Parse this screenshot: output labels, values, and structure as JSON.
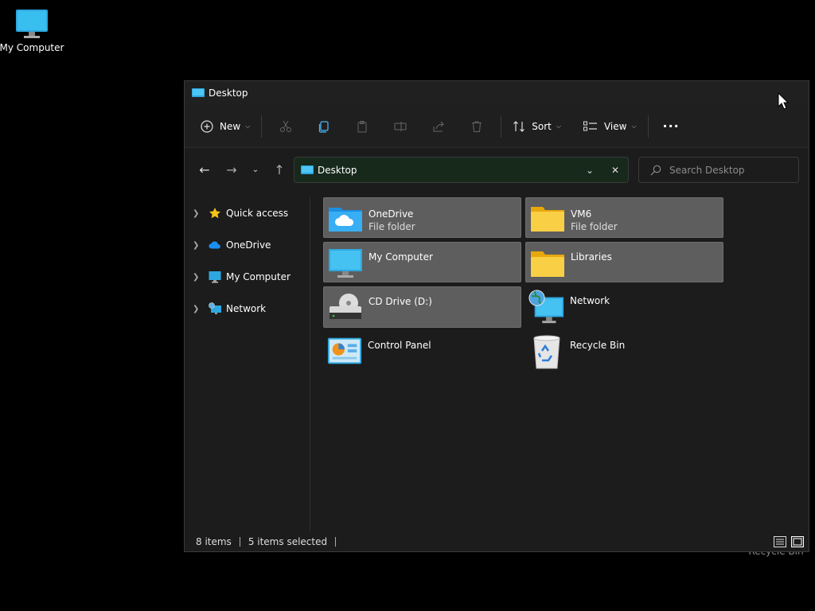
{
  "desktop": {
    "my_computer_label": "My Computer",
    "recycle_bin_label": "Recycle Bin"
  },
  "window": {
    "title": "Desktop"
  },
  "toolbar": {
    "new_label": "New",
    "sort_label": "Sort",
    "view_label": "View",
    "more_label": "···"
  },
  "address": {
    "path": "Desktop"
  },
  "search": {
    "placeholder": "Search Desktop"
  },
  "sidebar": {
    "items": [
      {
        "label": "Quick access",
        "icon": "star-icon"
      },
      {
        "label": "OneDrive",
        "icon": "cloud-icon"
      },
      {
        "label": "My Computer",
        "icon": "monitor-icon"
      },
      {
        "label": "Network",
        "icon": "network-icon"
      }
    ]
  },
  "files": [
    {
      "name": "OneDrive",
      "type": "File folder",
      "icon": "onedrive-folder-icon",
      "selected": true
    },
    {
      "name": "VM6",
      "type": "File folder",
      "icon": "folder-icon",
      "selected": true
    },
    {
      "name": "My Computer",
      "type": "",
      "icon": "monitor-icon",
      "selected": true
    },
    {
      "name": "Libraries",
      "type": "",
      "icon": "folder-icon",
      "selected": true
    },
    {
      "name": "CD Drive (D:)",
      "type": "",
      "icon": "cd-drive-icon",
      "selected": true
    },
    {
      "name": "Network",
      "type": "",
      "icon": "network-icon",
      "selected": false
    },
    {
      "name": "Control Panel",
      "type": "",
      "icon": "control-panel-icon",
      "selected": false
    },
    {
      "name": "Recycle Bin",
      "type": "",
      "icon": "recycle-bin-icon",
      "selected": false
    }
  ],
  "status": {
    "item_count": "8 items",
    "selection": "5 items selected"
  },
  "colors": {
    "selection_bg": "#5e5e5e",
    "address_bg": "#17291b",
    "window_bg": "#1c1c1c"
  }
}
